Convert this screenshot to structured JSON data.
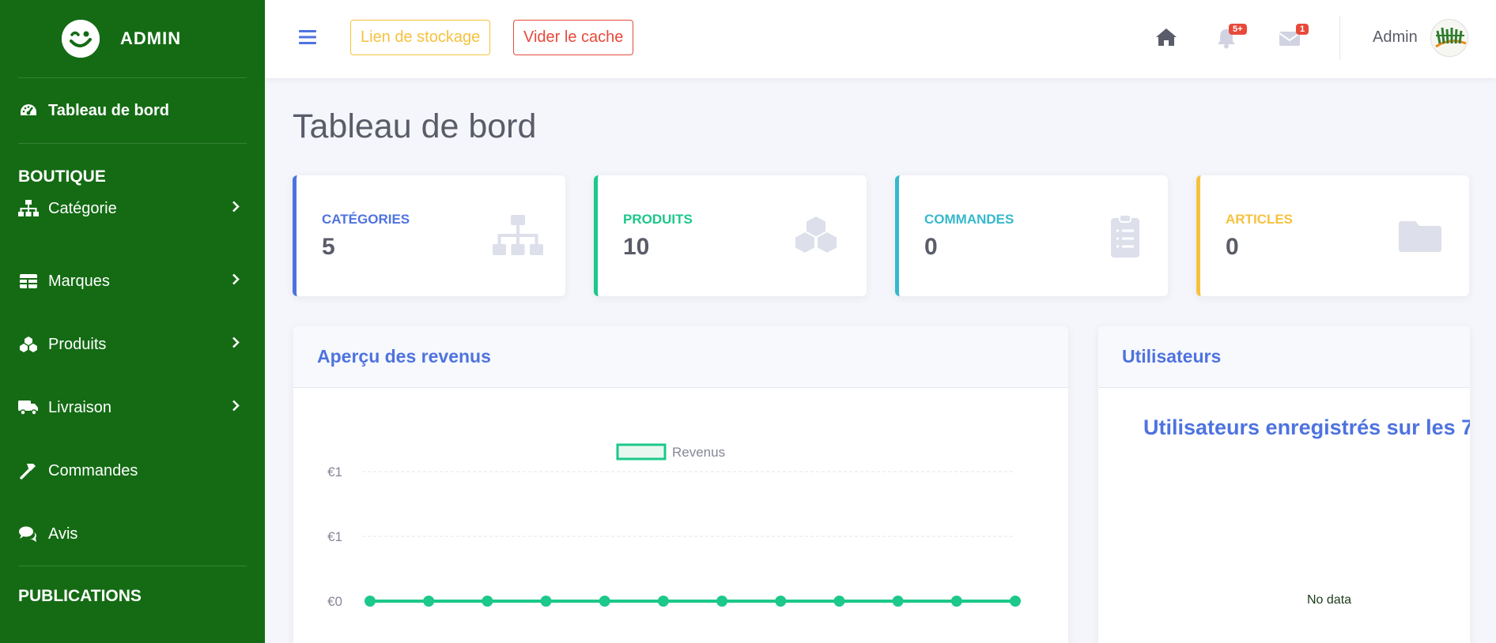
{
  "brand": {
    "name": "ADMIN"
  },
  "sidebar": {
    "dashboard": "Tableau de bord",
    "shop_heading": "BOUTIQUE",
    "items": [
      {
        "label": "Catégorie",
        "icon": "sitemap-icon",
        "has_children": true
      },
      {
        "label": "Marques",
        "icon": "table-icon",
        "has_children": true
      },
      {
        "label": "Produits",
        "icon": "cubes-icon",
        "has_children": true
      },
      {
        "label": "Livraison",
        "icon": "truck-icon",
        "has_children": true
      },
      {
        "label": "Commandes",
        "icon": "hammer-icon",
        "has_children": false
      },
      {
        "label": "Avis",
        "icon": "comments-icon",
        "has_children": false
      }
    ],
    "publications_heading": "PUBLICATIONS"
  },
  "topbar": {
    "storage_link": "Lien de stockage",
    "clear_cache": "Vider le cache",
    "alerts_badge": "5+",
    "messages_badge": "1",
    "user_name": "Admin"
  },
  "page": {
    "title": "Tableau de bord"
  },
  "cards": [
    {
      "label": "Catégories",
      "value": "5",
      "color": "#4e73df",
      "icon": "sitemap-icon"
    },
    {
      "label": "Produits",
      "value": "10",
      "color": "#1cc88a",
      "icon": "cubes-icon"
    },
    {
      "label": "Commandes",
      "value": "0",
      "color": "#36b9cc",
      "icon": "clipboard-icon"
    },
    {
      "label": "Articles",
      "value": "0",
      "color": "#f6c23e",
      "icon": "folder-icon"
    }
  ],
  "revenue_panel": {
    "title": "Aperçu des revenus"
  },
  "users_panel": {
    "title": "Utilisateurs",
    "chart_title": "Utilisateurs enregistrés sur les 7",
    "no_data": "No data"
  },
  "chart_data": {
    "type": "line",
    "title": "",
    "series": [
      {
        "name": "Revenus",
        "color": "#1cc88a",
        "values": [
          0,
          0,
          0,
          0,
          0,
          0,
          0,
          0,
          0,
          0,
          0,
          0
        ]
      }
    ],
    "y_ticks": [
      "€1",
      "€1",
      "€0"
    ],
    "legend": "top-center",
    "grid": true
  }
}
